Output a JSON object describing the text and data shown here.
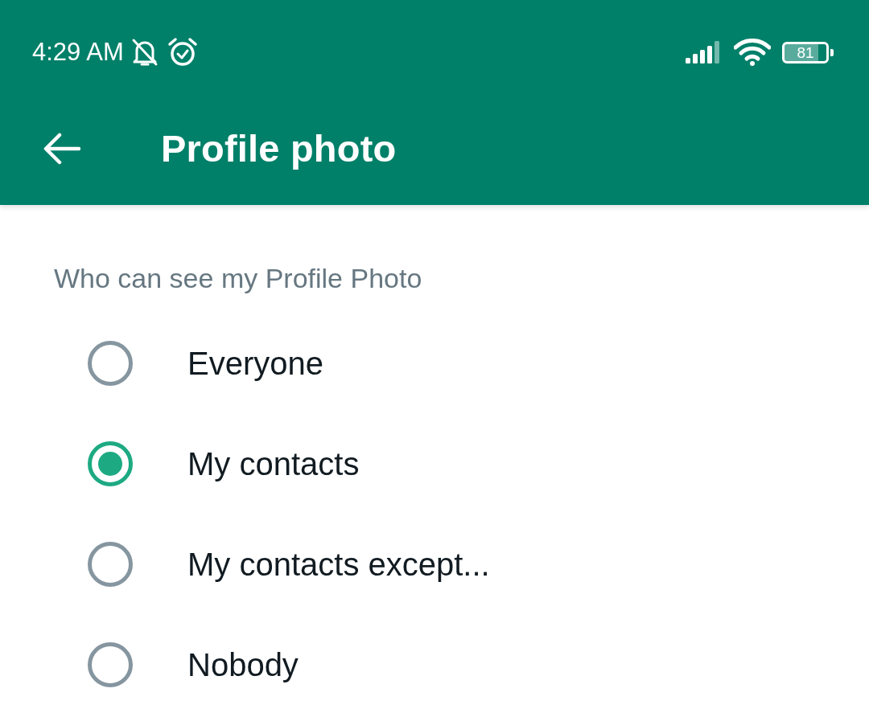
{
  "status_bar": {
    "time": "4:29 AM",
    "battery": "81"
  },
  "toolbar": {
    "title": "Profile photo"
  },
  "section": {
    "header": "Who can see my Profile Photo",
    "options": [
      {
        "label": "Everyone",
        "selected": false
      },
      {
        "label": "My contacts",
        "selected": true
      },
      {
        "label": "My contacts except...",
        "selected": false
      },
      {
        "label": "Nobody",
        "selected": false
      }
    ]
  }
}
